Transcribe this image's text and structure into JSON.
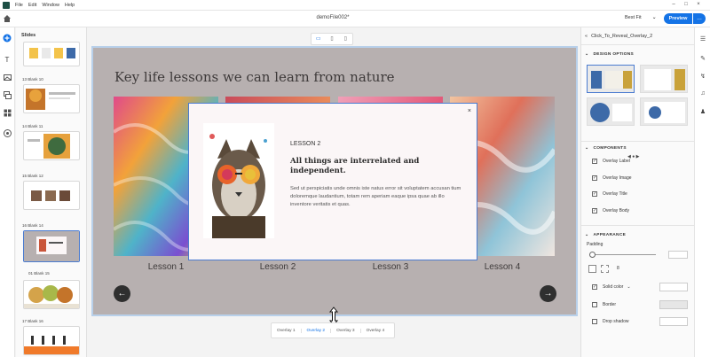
{
  "window": {
    "menu": [
      "File",
      "Edit",
      "Window",
      "Help"
    ]
  },
  "header": {
    "doc_title": "demoFile002*",
    "fit_label": "Best Fit",
    "preview_label": "Preview",
    "more_label": "…"
  },
  "slides_panel": {
    "title": "Slides",
    "labels": [
      "13 Blank 10",
      "14 Blank 11",
      "15 Blank 12",
      "16 Blank 14",
      "01 Blank 15",
      "17 Blank 16"
    ]
  },
  "stage": {
    "title": "Key life lessons we can learn from nature",
    "lessons": [
      "Lesson 1",
      "Lesson 2",
      "Lesson 3",
      "Lesson 4"
    ]
  },
  "overlay": {
    "close": "×",
    "label": "LESSON 2",
    "title": "All things are interrelated and independent.",
    "body": "Sed ut perspiciatis unde omnis iste natus error sit voluptatem accusan tium doloremque laudantium, totam rem aperiam eaque ipsa quae ab illo inventore veritatis et quas."
  },
  "tabs": [
    "Overlay 1",
    "Overlay 2",
    "Overlay 3",
    "Overlay 4"
  ],
  "props": {
    "breadcrumb": "Click_To_Reveal_Overlay_2",
    "design_options": "DESIGN OPTIONS",
    "components": "COMPONENTS",
    "component_items": [
      "Overlay Label",
      "Overlay Image",
      "Overlay Title",
      "Overlay Body"
    ],
    "appearance": "APPEARANCE",
    "padding": "Padding",
    "padding_value": "8",
    "solid_color": "Solid color",
    "border": "Border",
    "drop_shadow": "Drop shadow"
  },
  "colors": {
    "accent": "#1473e6",
    "stage_bg": "#b7b0b0",
    "overlay_bg": "#fbf6f7"
  }
}
